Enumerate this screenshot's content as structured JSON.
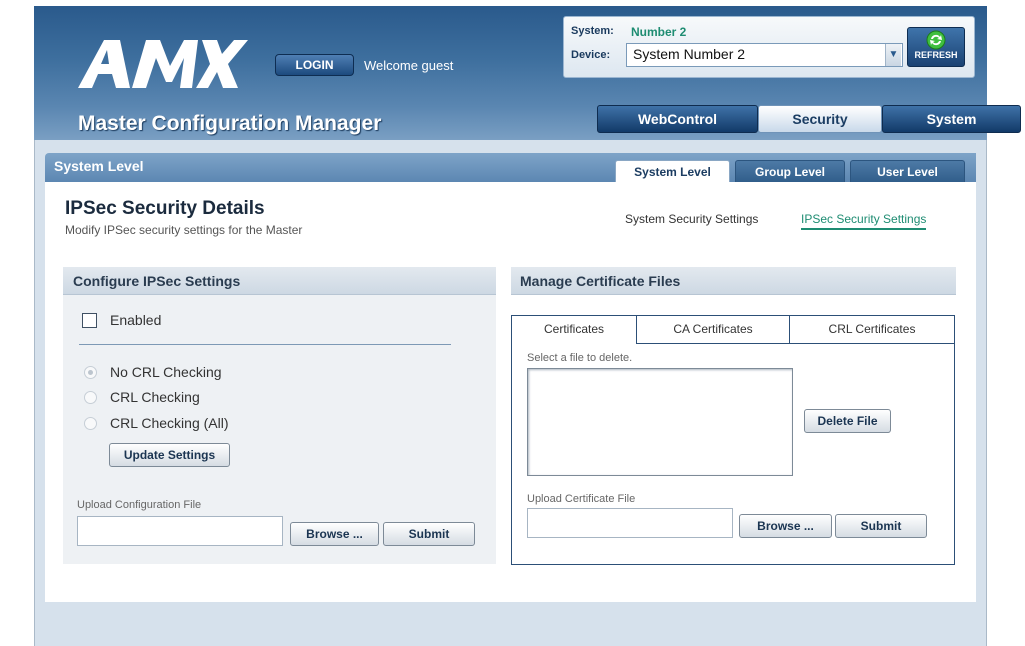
{
  "header": {
    "logo_text": "AMX",
    "login_label": "LOGIN",
    "welcome_text": "Welcome guest",
    "app_title": "Master Configuration Manager",
    "system_label": "System:",
    "system_value": "Number 2",
    "device_label": "Device:",
    "device_selected": "System Number 2",
    "refresh_label": "REFRESH",
    "main_tabs": [
      {
        "label": "WebControl",
        "active": false
      },
      {
        "label": "Security",
        "active": true
      },
      {
        "label": "System",
        "active": false
      }
    ]
  },
  "level_bar": {
    "title": "System Level",
    "tabs": [
      {
        "label": "System Level",
        "active": true
      },
      {
        "label": "Group Level",
        "active": false
      },
      {
        "label": "User Level",
        "active": false
      }
    ]
  },
  "page": {
    "title": "IPSec Security Details",
    "subtitle": "Modify IPSec security settings for the Master",
    "links": [
      "System Security Settings",
      "IPSec Security Settings"
    ]
  },
  "configure": {
    "header": "Configure IPSec Settings",
    "enabled_label": "Enabled",
    "enabled_checked": false,
    "radios": [
      {
        "label": "No CRL Checking",
        "selected": true
      },
      {
        "label": "CRL Checking",
        "selected": false
      },
      {
        "label": "CRL Checking (All)",
        "selected": false
      }
    ],
    "update_button": "Update Settings",
    "upload_label": "Upload Configuration File",
    "browse_button": "Browse ...",
    "submit_button": "Submit"
  },
  "certificates": {
    "header": "Manage Certificate Files",
    "tabs": [
      "Certificates",
      "CA Certificates",
      "CRL Certificates"
    ],
    "active_tab": "Certificates",
    "select_label": "Select a file to delete.",
    "delete_button": "Delete File",
    "upload_label": "Upload Certificate File",
    "browse_button": "Browse ...",
    "submit_button": "Submit"
  },
  "colors": {
    "header_blue": "#2a5a8c",
    "accent_green": "#1e8c72",
    "panel_bg": "#eef1f4"
  }
}
